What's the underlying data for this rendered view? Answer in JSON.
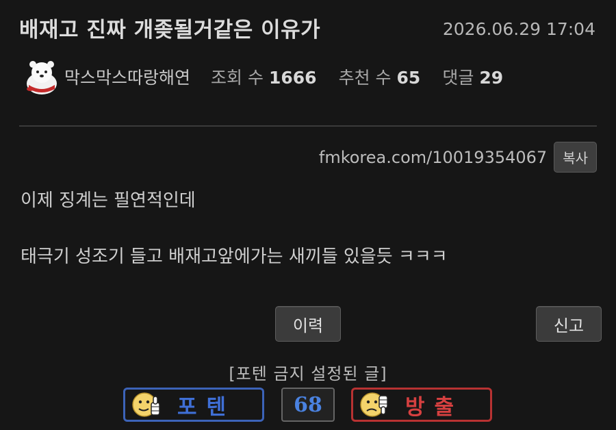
{
  "post": {
    "title": "배재고 진짜 개좆될거같은 이유가",
    "date": "2026.06.29 17:04",
    "author": "막스막스따랑해연",
    "views_label": "조회 수",
    "views": "1666",
    "likes_label": "추천 수",
    "likes": "65",
    "comments_label": "댓글",
    "comments": "29",
    "url": "fmkorea.com/10019354067",
    "copy_label": "복사",
    "body": [
      "이제 징계는 필연적인데",
      "태극기 성조기 들고 배재고앞에가는 새끼들 있을듯 ㅋㅋㅋ"
    ]
  },
  "actions": {
    "history_label": "이력",
    "report_label": "신고"
  },
  "vote": {
    "notice": "[포텐 금지 설정된 글]",
    "upvote_label": "포텐",
    "count": "68",
    "downvote_label": "방출"
  },
  "colors": {
    "background": "#161616",
    "upvote_border": "#3c63b8",
    "upvote_text": "#3f6fd6",
    "downvote_border": "#b83232",
    "downvote_text": "#d64040",
    "count_text": "#4a82e0"
  },
  "icons": {
    "avatar": "polar-bear-avatar-icon",
    "upvote": "thumbs-up-face-icon",
    "downvote": "thumbs-down-face-icon"
  }
}
